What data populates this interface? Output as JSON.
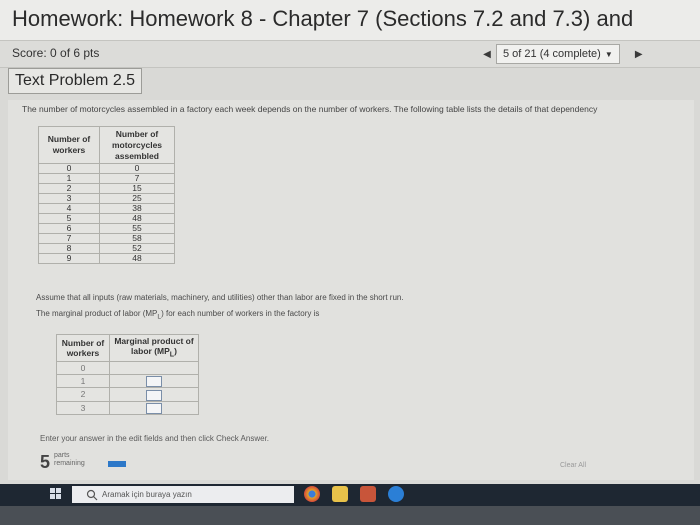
{
  "header": {
    "title": "Homework: Homework 8 - Chapter 7 (Sections 7.2 and 7.3) and",
    "score": "Score: 0 of 6 pts",
    "progress": "5 of 21 (4 complete)"
  },
  "section": {
    "title": "Text Problem 2.5"
  },
  "problem": {
    "intro": "The number of motorcycles assembled in a factory each week depends on the number of workers. The following table lists the details of that dependency",
    "table1": {
      "col1": "Number of workers",
      "col2": "Number of motorcycles assembled",
      "rows": [
        [
          "0",
          "0"
        ],
        [
          "1",
          "7"
        ],
        [
          "2",
          "15"
        ],
        [
          "3",
          "25"
        ],
        [
          "4",
          "38"
        ],
        [
          "5",
          "48"
        ],
        [
          "6",
          "55"
        ],
        [
          "7",
          "58"
        ],
        [
          "8",
          "52"
        ],
        [
          "9",
          "48"
        ]
      ]
    },
    "assume": "Assume that all inputs (raw materials, machinery, and utilities) other than labor are fixed in the short run.",
    "mp_text": "The marginal product of labor (MP",
    "mp_sub": "L",
    "mp_text_end": ") for each number of workers in the factory is",
    "table2": {
      "col1": "Number of workers",
      "col2_line1": "Marginal product of",
      "col2_line2": "labor (MP",
      "col2_sub": "L",
      "col2_end": ")",
      "rows": [
        "0",
        "1",
        "2",
        "3"
      ]
    }
  },
  "footer": {
    "instruction": "Enter your answer in the edit fields and then click Check Answer.",
    "parts_count": "5",
    "parts_label1": "parts",
    "parts_label2": "remaining",
    "clear_all": "Clear All"
  },
  "taskbar": {
    "search_placeholder": "Aramak için buraya yazın",
    "colors": {
      "bar": "#1e2732",
      "accent": "#2d78c8"
    }
  }
}
